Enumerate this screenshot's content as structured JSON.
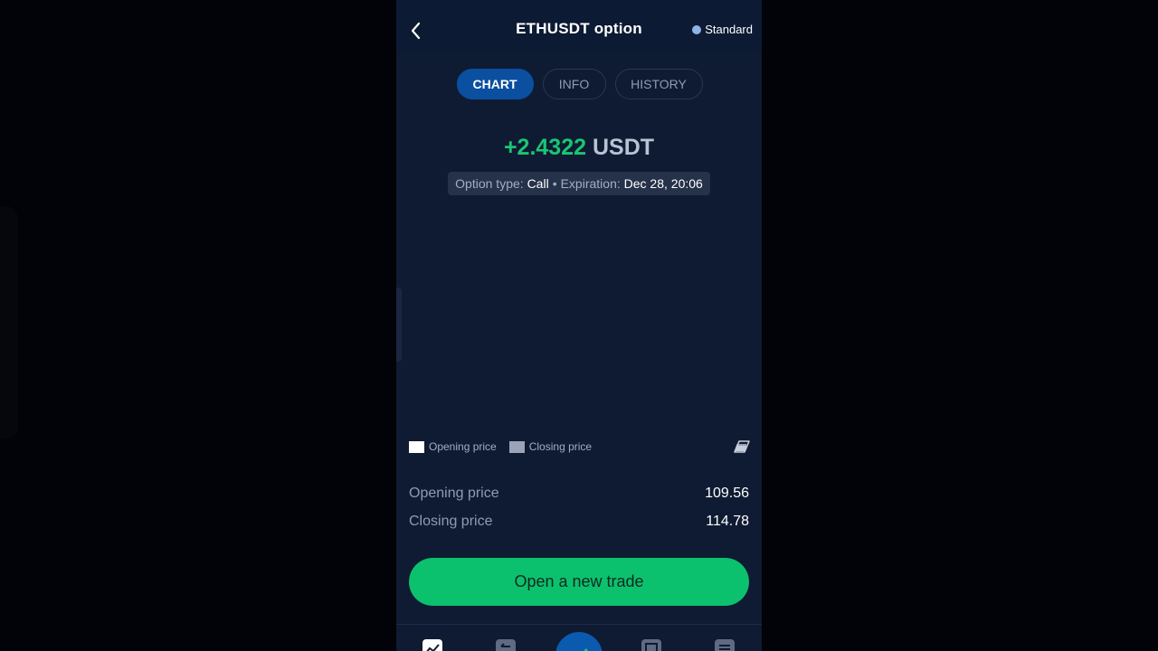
{
  "header": {
    "title": "ETHUSDT option",
    "account_type": "Standard",
    "account_dot_color": "#8fb3e6",
    "back_icon": "chevron-left-icon"
  },
  "tabs": [
    {
      "label": "CHART",
      "active": true
    },
    {
      "label": "INFO",
      "active": false
    },
    {
      "label": "HISTORY",
      "active": false
    }
  ],
  "result": {
    "amount": "+2.4322",
    "currency": "USDT",
    "amount_color": "#1bc573"
  },
  "meta": {
    "option_type_label": "Option type:",
    "option_type_value": "Call",
    "separator": "•",
    "expiration_label": "Expiration:",
    "expiration_value": "Dec 28, 20:06"
  },
  "legend": {
    "opening_label": "Opening price",
    "opening_color": "#ffffff",
    "closing_label": "Closing price",
    "closing_color": "#9aa3b8",
    "clear_icon": "eraser-icon"
  },
  "prices": {
    "opening_label": "Opening price",
    "opening_value": "109.56",
    "closing_label": "Closing price",
    "closing_value": "114.78"
  },
  "cta": {
    "label": "Open a new trade",
    "color": "#0cc16d"
  },
  "bottom_nav": {
    "items": [
      "chart-icon",
      "exchange-icon",
      "trade-arrow-icon",
      "wallet-icon",
      "menu-icon"
    ]
  }
}
